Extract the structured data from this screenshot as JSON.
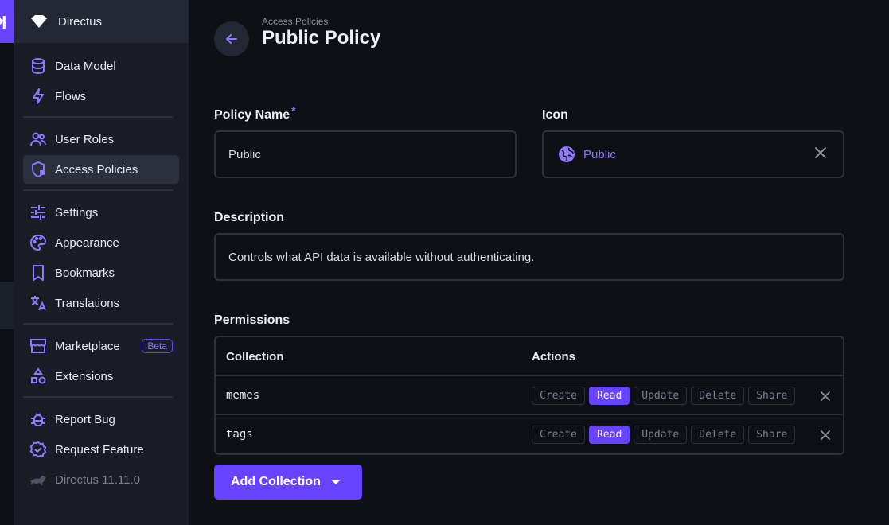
{
  "app": {
    "name": "Directus"
  },
  "sidebar": {
    "items": [
      {
        "label": "Data Model",
        "icon": "database-icon"
      },
      {
        "label": "Flows",
        "icon": "bolt-icon"
      },
      {
        "label": "User Roles",
        "icon": "users-icon"
      },
      {
        "label": "Access Policies",
        "icon": "shield-lock-icon",
        "active": true
      },
      {
        "label": "Settings",
        "icon": "sliders-icon"
      },
      {
        "label": "Appearance",
        "icon": "palette-icon"
      },
      {
        "label": "Bookmarks",
        "icon": "bookmark-icon"
      },
      {
        "label": "Translations",
        "icon": "translate-icon"
      },
      {
        "label": "Marketplace",
        "icon": "storefront-icon",
        "badge": "Beta"
      },
      {
        "label": "Extensions",
        "icon": "shapes-icon"
      },
      {
        "label": "Report Bug",
        "icon": "bug-icon"
      },
      {
        "label": "Request Feature",
        "icon": "verified-icon"
      },
      {
        "label": "Directus 11.11.0",
        "icon": "rabbit-icon"
      }
    ]
  },
  "header": {
    "breadcrumb": "Access Policies",
    "title": "Public Policy"
  },
  "form": {
    "policy_name_label": "Policy Name",
    "required_mark": "*",
    "policy_name_value": "Public",
    "icon_label": "Icon",
    "icon_value": "Public",
    "description_label": "Description",
    "description_value": "Controls what API data is available without authenticating.",
    "permissions_label": "Permissions"
  },
  "permissions": {
    "col_collection": "Collection",
    "col_actions": "Actions",
    "action_labels": [
      "Create",
      "Read",
      "Update",
      "Delete",
      "Share"
    ],
    "rows": [
      {
        "collection": "memes",
        "enabled": [
          "Read"
        ]
      },
      {
        "collection": "tags",
        "enabled": [
          "Read"
        ]
      }
    ]
  },
  "add_collection_label": "Add Collection",
  "colors": {
    "accent": "#6644ff",
    "background": "#0e1016",
    "sidebar": "#1a1d25"
  }
}
